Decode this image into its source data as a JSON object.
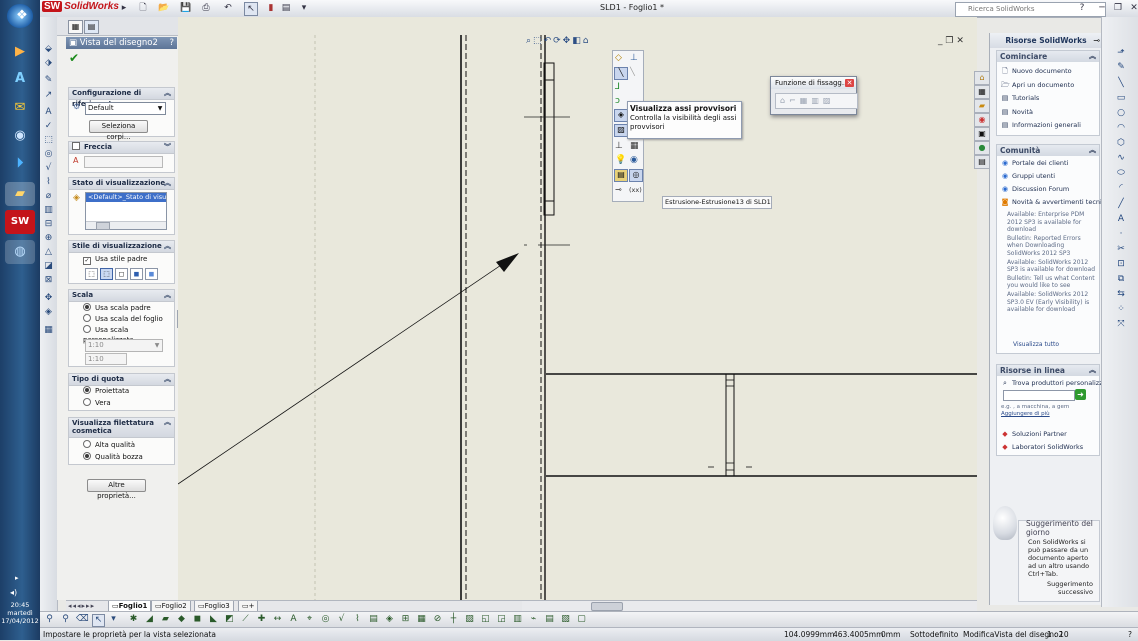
{
  "taskbar": {
    "clock_time": "20:45",
    "clock_day": "martedì",
    "clock_date": "17/04/2012"
  },
  "app": {
    "logo_text": "SolidWorks",
    "logo_badge": "SW",
    "doc_title": "SLD1 - Foglio1 *",
    "search_placeholder": "Ricerca SolidWorks",
    "help_glyph": "?"
  },
  "property_manager": {
    "title": "Vista del disegno2",
    "ref_config": {
      "header": "Configurazione di riferimento",
      "value": "Default",
      "button": "Seleziona corpi..."
    },
    "arrow": {
      "header": "Freccia"
    },
    "display_state": {
      "header": "Stato di visualizzazione",
      "value": "<Default>_Stato di visua"
    },
    "display_style": {
      "header": "Stile di visualizzazione",
      "use_parent": "Usa stile padre"
    },
    "scale": {
      "header": "Scala",
      "options": [
        "Usa scala padre",
        "Usa scala del foglio",
        "Usa scala personalizzata"
      ],
      "selected": "Usa scala padre",
      "combo": "1:10",
      "field": "1:10"
    },
    "dim_type": {
      "header": "Tipo di quota",
      "options": [
        "Proiettata",
        "Vera"
      ],
      "selected": "Proiettata"
    },
    "thread": {
      "header": "Visualizza filettatura cosmetica",
      "options": [
        "Alta qualità",
        "Qualità bozza"
      ],
      "selected": "Qualità bozza"
    },
    "more_button": "Altre proprietà..."
  },
  "canvas": {
    "tooltip_title": "Visualizza assi provvisori",
    "tooltip_body": "Controlla la visibilità degli assi provvisori",
    "fix_popup_title": "Funzione di fissagg...",
    "hover_label": "Estrusione-Estrusione13 di SLD1",
    "toolbar_text": "(xx)"
  },
  "resources": {
    "title": "Risorse SolidWorks",
    "start": {
      "header": "Cominciare",
      "items": [
        "Nuovo documento",
        "Apri un documento",
        "Tutorials",
        "Novità",
        "Informazioni generali"
      ]
    },
    "community": {
      "header": "Comunità",
      "items": [
        "Portale dei clienti",
        "Gruppi utenti",
        "Discussion Forum",
        "Novità & avvertimenti tecnici"
      ],
      "news": [
        "Available: Enterprise PDM 2012 SP3 is available for download",
        "Bulletin: Reported Errors when Downloading SolidWorks 2012 SP3",
        "Available: SolidWorks 2012 SP3 is available for download",
        "Bulletin: Tell us what Content you would like to see",
        "Available: SolidWorks 2012 SP3.0 EV (Early Visibility) is available for download"
      ],
      "view_all": "Visualizza tutto"
    },
    "online": {
      "header": "Risorse in linea",
      "find_label": "Trova produttori personalizzati",
      "hint": "e.g. , a macchina, a gem",
      "hint_link": "Aggiungere di più",
      "items": [
        "Soluzioni Partner",
        "Laboratori SolidWorks"
      ]
    },
    "tip": {
      "header": "Suggerimento del giorno",
      "text": "Con SolidWorks si può passare da un documento aperto ad un altro usando Ctrl+Tab.",
      "next": "Suggerimento successivo"
    }
  },
  "sheets": {
    "tabs": [
      "Foglio1",
      "Foglio2",
      "Foglio3"
    ],
    "active": "Foglio1"
  },
  "status_bar": {
    "message": "Impostare le proprietà per la vista selezionata",
    "x": "104.0999mm",
    "y": "463.4005mm",
    "z": "0mm",
    "state": "Sottodefinito",
    "mode": "ModificaVista del disegno2",
    "scale": "1 : 10"
  }
}
